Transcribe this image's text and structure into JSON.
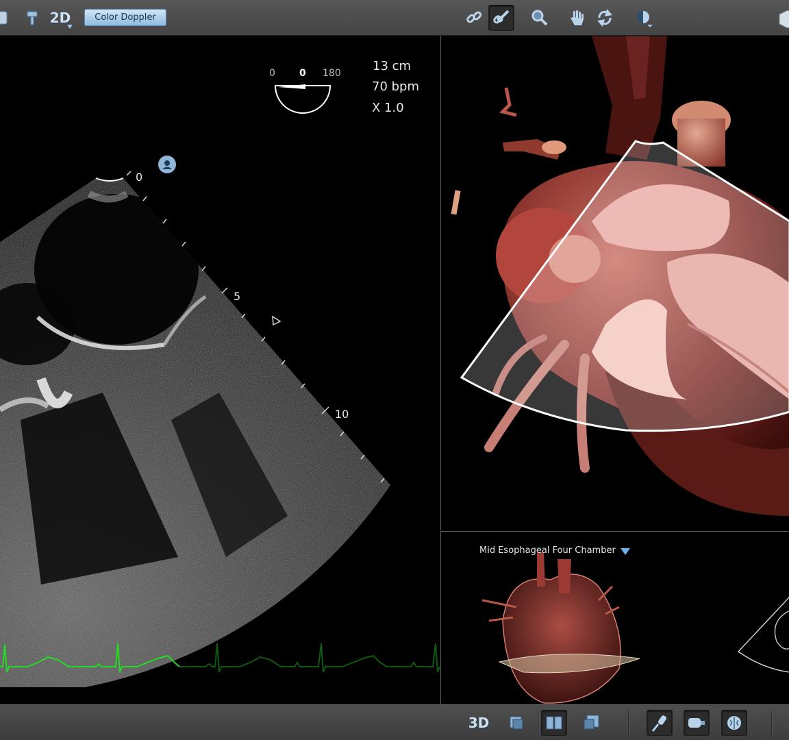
{
  "toolbar": {
    "mode_2d_label": "2D",
    "color_doppler_label": "Color Doppler",
    "mode_3d_label": "3D"
  },
  "echo": {
    "depth": "13 cm",
    "heart_rate": "70 bpm",
    "zoom": "X 1.0",
    "angle_min": "0",
    "angle_value": "0",
    "angle_max": "180",
    "depth_marks": [
      "0",
      "5",
      "10"
    ]
  },
  "mini_view": {
    "view_name": "Mid Esophageal Four Chamber"
  },
  "colors": {
    "toolbar_bg": "#4a4a4a",
    "doppler_button": "#a9cdee",
    "ecg_trace": "#22dd22",
    "ecg_trace_dim": "#0f5a0f",
    "heart_tissue": "#8a2a24"
  },
  "icons": [
    "probe-icon",
    "anchor-icon",
    "link-icon",
    "probe-link-icon",
    "zoom-icon",
    "hand-icon",
    "rotate-icon",
    "contrast-icon",
    "cube-icon",
    "single-view-icon",
    "split-view-icon",
    "overlay-view-icon",
    "probe-tool-icon",
    "probe-device-icon",
    "brain-icon"
  ]
}
